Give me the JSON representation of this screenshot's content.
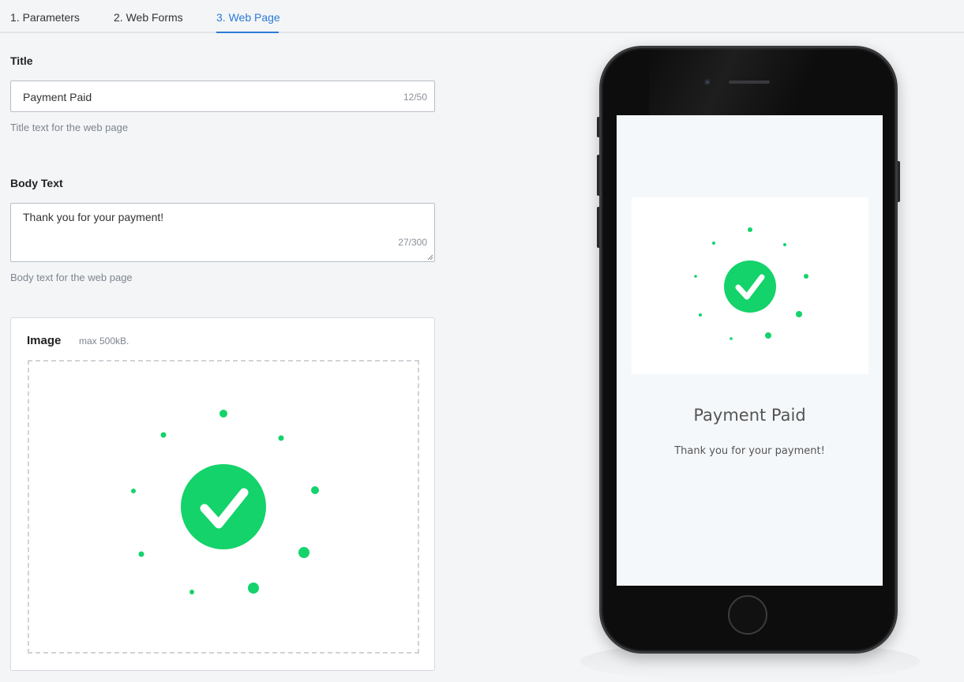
{
  "tabs": [
    {
      "label": "1. Parameters",
      "active": false
    },
    {
      "label": "2. Web Forms",
      "active": false
    },
    {
      "label": "3. Web Page",
      "active": true
    }
  ],
  "colors": {
    "accent": "#2a7ad8",
    "success_green": "#14d36b",
    "background": "#f4f5f7"
  },
  "form": {
    "title": {
      "label": "Title",
      "value": "Payment Paid",
      "counter": "12/50",
      "help": "Title text for the web page"
    },
    "body": {
      "label": "Body Text",
      "value": "Thank you for your payment!",
      "counter": "27/300",
      "help": "Body text for the web page"
    },
    "image": {
      "label": "Image",
      "hint": "max 500kB.",
      "icon": "success-check-icon"
    }
  },
  "preview": {
    "title": "Payment Paid",
    "body": "Thank you for your payment!",
    "image_icon": "success-check-icon"
  }
}
